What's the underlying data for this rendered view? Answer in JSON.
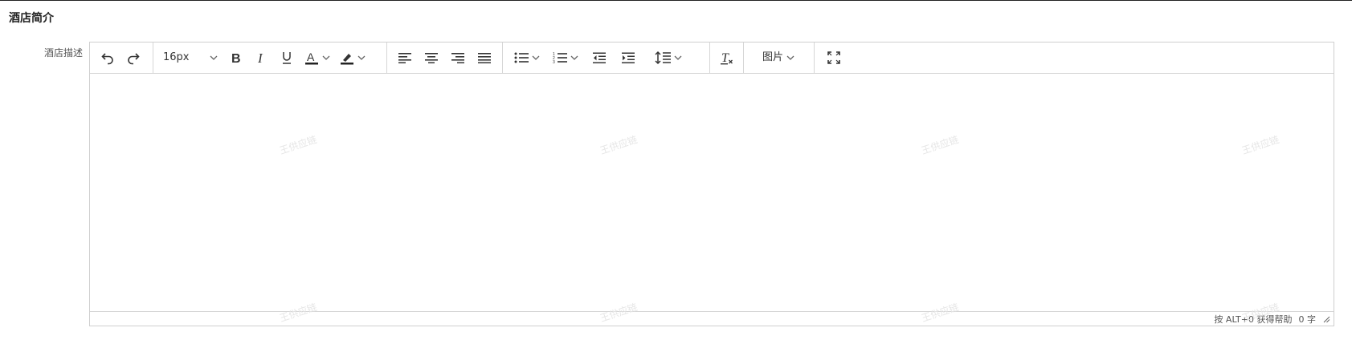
{
  "section": {
    "title": "酒店简介"
  },
  "field": {
    "label": "酒店描述"
  },
  "toolbar": {
    "font_size": "16px",
    "image_label": "图片"
  },
  "editor": {
    "content": ""
  },
  "status": {
    "help": "按 ALT+0 获得帮助",
    "word_count": "0 字"
  },
  "watermark": {
    "text": "王供应链"
  },
  "icons": [
    "undo-icon",
    "redo-icon",
    "font-size-dropdown",
    "bold-icon",
    "italic-icon",
    "underline-icon",
    "font-color-icon",
    "highlight-icon",
    "align-left-icon",
    "align-center-icon",
    "align-right-icon",
    "align-justify-icon",
    "bullet-list-icon",
    "numbered-list-icon",
    "outdent-icon",
    "indent-icon",
    "line-height-icon",
    "clear-format-icon",
    "fullscreen-icon",
    "chevron-down-icon",
    "resize-handle-icon"
  ]
}
